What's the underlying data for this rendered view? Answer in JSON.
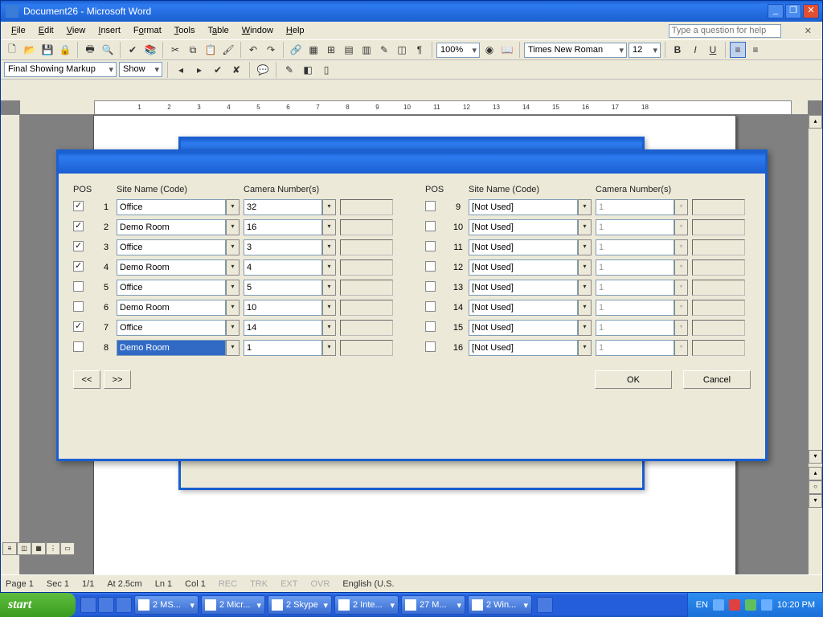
{
  "taskbar": {
    "start": "start",
    "tasks": [
      "2 MS...",
      "2 Micr...",
      "2 Skype",
      "2 Inte...",
      "27 M...",
      "2 Win..."
    ],
    "lang": "EN",
    "clock": "10:20 PM"
  },
  "word": {
    "title": "Document26 - Microsoft Word",
    "menu": [
      "File",
      "Edit",
      "View",
      "Insert",
      "Format",
      "Tools",
      "Table",
      "Window",
      "Help"
    ],
    "help_placeholder": "Type a question for help",
    "font_name": "Times New Roman",
    "font_size": "12",
    "zoom": "100%",
    "review_mode": "Final Showing Markup",
    "review_show": "Show",
    "status": {
      "page": "Page 1",
      "sec": "Sec 1",
      "pages": "1/1",
      "at": "At 2.5cm",
      "ln": "Ln 1",
      "col": "Col 1",
      "rec": "REC",
      "trk": "TRK",
      "ext": "EXT",
      "ovr": "OVR",
      "lang": "English (U.S."
    }
  },
  "dialog": {
    "hdr_pos": "POS",
    "hdr_site": "Site Name (Code)",
    "hdr_cam": "Camera Number(s)",
    "ok": "OK",
    "cancel": "Cancel",
    "prev": "<<",
    "next": ">>",
    "rowsL": [
      {
        "p": "1",
        "c": true,
        "s": "Office",
        "n": "32"
      },
      {
        "p": "2",
        "c": true,
        "s": "Demo Room",
        "n": "16"
      },
      {
        "p": "3",
        "c": true,
        "s": "Office",
        "n": "3"
      },
      {
        "p": "4",
        "c": true,
        "s": "Demo Room",
        "n": "4"
      },
      {
        "p": "5",
        "c": false,
        "s": "Office",
        "n": "5"
      },
      {
        "p": "6",
        "c": false,
        "s": "Demo Room",
        "n": "10"
      },
      {
        "p": "7",
        "c": true,
        "s": "Office",
        "n": "14"
      },
      {
        "p": "8",
        "c": false,
        "s": "Demo Room",
        "n": "1",
        "hl": true
      }
    ],
    "rowsR": [
      {
        "p": "9",
        "c": false,
        "s": "[Not Used]",
        "n": "1",
        "d": true
      },
      {
        "p": "10",
        "c": false,
        "s": "[Not Used]",
        "n": "1",
        "d": true
      },
      {
        "p": "11",
        "c": false,
        "s": "[Not Used]",
        "n": "1",
        "d": true
      },
      {
        "p": "12",
        "c": false,
        "s": "[Not Used]",
        "n": "1",
        "d": true
      },
      {
        "p": "13",
        "c": false,
        "s": "[Not Used]",
        "n": "1",
        "d": true
      },
      {
        "p": "14",
        "c": false,
        "s": "[Not Used]",
        "n": "1",
        "d": true
      },
      {
        "p": "15",
        "c": false,
        "s": "[Not Used]",
        "n": "1",
        "d": true
      },
      {
        "p": "16",
        "c": false,
        "s": "[Not Used]",
        "n": "1",
        "d": true
      }
    ]
  }
}
